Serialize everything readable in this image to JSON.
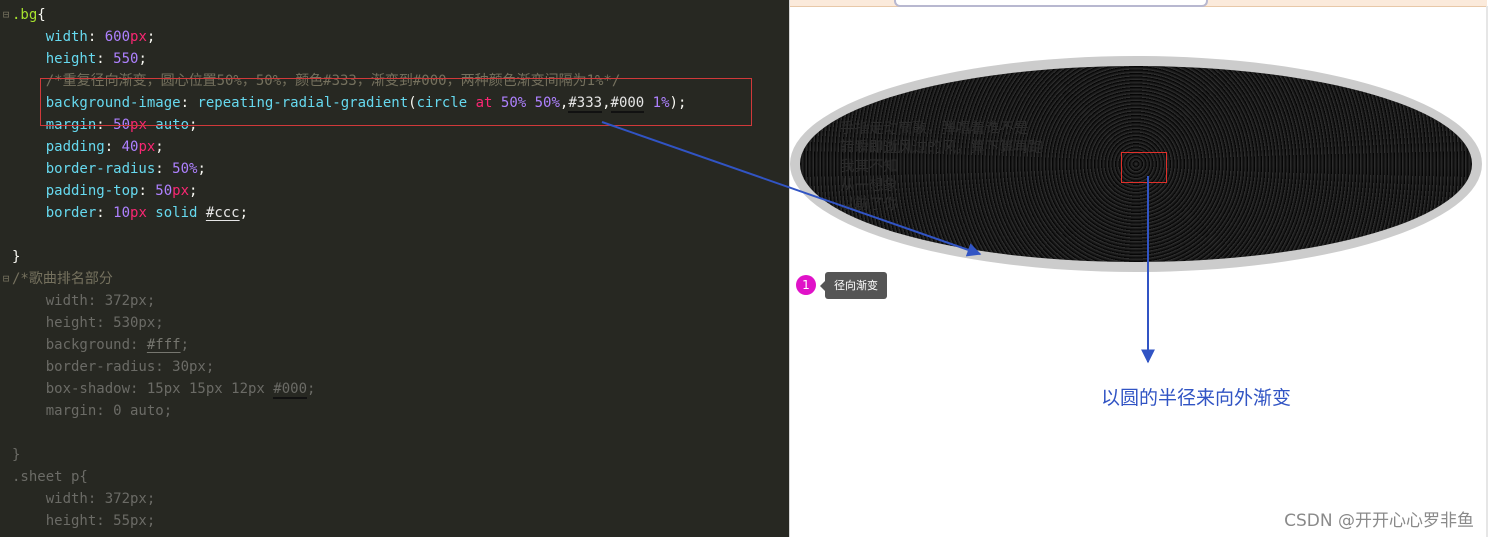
{
  "editor": {
    "lines": [
      [
        {
          "t": ".bg",
          "c": "sel"
        },
        {
          "t": "{",
          "c": "pun"
        }
      ],
      [
        {
          "t": "    width",
          "c": "prop"
        },
        {
          "t": ": ",
          "c": "pun"
        },
        {
          "t": "600",
          "c": "num"
        },
        {
          "t": "px",
          "c": "unit"
        },
        {
          "t": ";",
          "c": "pun"
        }
      ],
      [
        {
          "t": "    height",
          "c": "prop"
        },
        {
          "t": ": ",
          "c": "pun"
        },
        {
          "t": "550",
          "c": "num"
        },
        {
          "t": ";",
          "c": "pun"
        }
      ],
      [
        {
          "t": "    /*重复径向渐变，圆心位置50%，50%，颜色#333，渐变到#000，两种颜色渐变间隔为1%*/",
          "c": "cmt"
        }
      ],
      [
        {
          "t": "    background-image",
          "c": "prop"
        },
        {
          "t": ": ",
          "c": "pun"
        },
        {
          "t": "repeating-radial-gradient",
          "c": "prop"
        },
        {
          "t": "(",
          "c": "pun"
        },
        {
          "t": "circle",
          "c": "prop"
        },
        {
          "t": " at ",
          "c": "kw"
        },
        {
          "t": "50%",
          "c": "num"
        },
        {
          "t": " ",
          "c": "pun"
        },
        {
          "t": "50%",
          "c": "num"
        },
        {
          "t": ",",
          "c": "pun"
        },
        {
          "t": "#333",
          "c": "hex ulb"
        },
        {
          "t": ",",
          "c": "pun"
        },
        {
          "t": "#000",
          "c": "hex ulb"
        },
        {
          "t": " ",
          "c": "pun"
        },
        {
          "t": "1%",
          "c": "num"
        },
        {
          "t": ");",
          "c": "pun"
        }
      ],
      [
        {
          "t": "    margin",
          "c": "prop"
        },
        {
          "t": ": ",
          "c": "pun"
        },
        {
          "t": "50",
          "c": "num"
        },
        {
          "t": "px",
          "c": "unit"
        },
        {
          "t": " auto",
          "c": "prop"
        },
        {
          "t": ";",
          "c": "pun"
        }
      ],
      [
        {
          "t": "    padding",
          "c": "prop"
        },
        {
          "t": ": ",
          "c": "pun"
        },
        {
          "t": "40",
          "c": "num"
        },
        {
          "t": "px",
          "c": "unit"
        },
        {
          "t": ";",
          "c": "pun"
        }
      ],
      [
        {
          "t": "    border-radius",
          "c": "prop"
        },
        {
          "t": ": ",
          "c": "pun"
        },
        {
          "t": "50%",
          "c": "num"
        },
        {
          "t": ";",
          "c": "pun"
        }
      ],
      [
        {
          "t": "    padding-top",
          "c": "prop"
        },
        {
          "t": ": ",
          "c": "pun"
        },
        {
          "t": "50",
          "c": "num"
        },
        {
          "t": "px",
          "c": "unit"
        },
        {
          "t": ";",
          "c": "pun"
        }
      ],
      [
        {
          "t": "    border",
          "c": "prop"
        },
        {
          "t": ": ",
          "c": "pun"
        },
        {
          "t": "10",
          "c": "num"
        },
        {
          "t": "px",
          "c": "unit"
        },
        {
          "t": " solid ",
          "c": "prop"
        },
        {
          "t": "#ccc",
          "c": "hex ul"
        },
        {
          "t": ";",
          "c": "pun"
        }
      ],
      [],
      [
        {
          "t": "}",
          "c": "pun"
        }
      ],
      [
        {
          "t": "/*歌曲排名部分",
          "c": "cmt"
        }
      ],
      [
        {
          "t": "    width: 372px;",
          "c": "dim"
        }
      ],
      [
        {
          "t": "    height: 530px;",
          "c": "dim"
        }
      ],
      [
        {
          "t": "    background: ",
          "c": "dim"
        },
        {
          "t": "#fff",
          "c": "dimw ul"
        },
        {
          "t": ";",
          "c": "dim"
        }
      ],
      [
        {
          "t": "    border-radius: 30px;",
          "c": "dim"
        }
      ],
      [
        {
          "t": "    box-shadow: 15px 15px 12px ",
          "c": "dim"
        },
        {
          "t": "#000",
          "c": "dim ulb"
        },
        {
          "t": ";",
          "c": "dim"
        }
      ],
      [
        {
          "t": "    margin: 0 auto;",
          "c": "dim"
        }
      ],
      [],
      [
        {
          "t": "}",
          "c": "dim"
        }
      ],
      [
        {
          "t": ".sheet p{",
          "c": "dim"
        }
      ],
      [
        {
          "t": "    width: 372px;",
          "c": "dim"
        }
      ],
      [
        {
          "t": "    height: 55px;",
          "c": "dim"
        }
      ]
    ],
    "fold_lines": [
      0,
      12
    ]
  },
  "preview": {
    "text_lines": [
      "手指走动高歌，弹唱着谁不是",
      "转瞬即逝风过的风，算下算再跑",
      "我其不知",
      "从一想象",
      "以前了你"
    ],
    "badge": "1",
    "tooltip": "径向渐变",
    "annotation": "以圆的半径来向外渐变",
    "watermark": "CSDN @开开心心罗非鱼"
  },
  "colors": {
    "editor_bg": "#272822",
    "highlight_box": "#d0393a",
    "arrow": "#3154c4",
    "badge": "#e012c8",
    "ellipse_border": "#cccccc"
  }
}
